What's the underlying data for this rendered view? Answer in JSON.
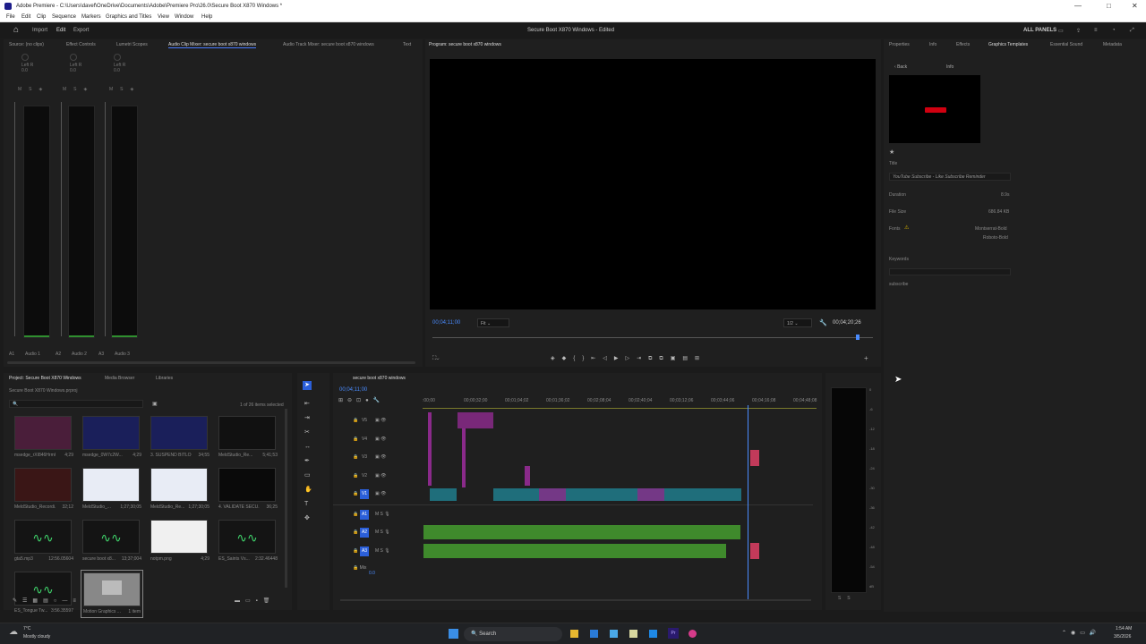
{
  "window": {
    "title": "Adobe Premiere - C:\\Users\\davef\\OneDrive\\Documents\\Adobe\\Premiere Pro\\26.0\\Secure Boot X870 Windows *"
  },
  "menu": [
    "File",
    "Edit",
    "Clip",
    "Sequence",
    "Markers",
    "Graphics and Titles",
    "View",
    "Window",
    "Help"
  ],
  "header": {
    "import": "Import",
    "edit": "Edit",
    "export": "Export",
    "project_title": "Secure Boot X870 Windows - Edited",
    "all_panels": "ALL PANELS"
  },
  "source_tabs": [
    "Source: (no clips)",
    "Effect Controls",
    "Lumetri Scopes",
    "Audio Clip Mixer: secure boot x870 windows",
    "Audio Track Mixer: secure boot x870 windows",
    "Text"
  ],
  "mixer": {
    "channels": [
      {
        "label": "Left R",
        "val": "0.0",
        "name": "Audio 1",
        "id": "A1"
      },
      {
        "label": "Left R",
        "val": "0.0",
        "name": "Audio 2",
        "id": "A2"
      },
      {
        "label": "Left R",
        "val": "0.0",
        "name": "Audio 3",
        "id": "A3"
      }
    ]
  },
  "program": {
    "tab": "Program: secure boot x870 windows",
    "timecode": "00;04;11;00",
    "fit": "Fit",
    "ratio": "1/2",
    "duration": "00;04;20;26"
  },
  "right_tabs": [
    "Properties",
    "Info",
    "Effects",
    "Graphics Templates",
    "Essential Sound",
    "Metadata"
  ],
  "graphics": {
    "back": "Back",
    "info": "Info",
    "title_label": "Title",
    "title_value": "YouTube Subscribe - Like Subscribe Reminder",
    "duration_label": "Duration",
    "duration_value": "8.9s",
    "filesize_label": "File Size",
    "filesize_value": "686.84 KB",
    "fonts_label": "Fonts",
    "font1": "Montserrat-Bold",
    "font2": "Roboto-Bold",
    "keywords_label": "Keywords",
    "keyword": "subscribe"
  },
  "project": {
    "tabs": [
      "Project: Secure Boot X870 Windows",
      "Media Browser",
      "Libraries"
    ],
    "file": "Secure Boot X870 Windows.prproj",
    "selected": "1 of 26 items selected",
    "items": [
      {
        "name": "msedge_rXI846HrmG...",
        "dur": "4;29"
      },
      {
        "name": "msedge_0W7c2W...",
        "dur": "4;29"
      },
      {
        "name": "3. SUSPEND BITLOC...",
        "dur": "34;55"
      },
      {
        "name": "MeldStudio_Re...",
        "dur": "5;41;53"
      },
      {
        "name": "MeldStudio_Recordi...",
        "dur": "32;12"
      },
      {
        "name": "MeldStudio_...",
        "dur": "1;27;30;05"
      },
      {
        "name": "MeldStudio_Re...",
        "dur": "1;27;30;05"
      },
      {
        "name": "4. VALIDATE SECU...",
        "dur": "36;25"
      },
      {
        "name": "gta5.mp3",
        "dur": "12:56.05604"
      },
      {
        "name": "secure boot x8...",
        "dur": "13;37;004"
      },
      {
        "name": "notpm.png",
        "dur": "4;29"
      },
      {
        "name": "ES_Saints Vs...",
        "dur": "2:32.46448"
      },
      {
        "name": "ES_Tongue Tw...",
        "dur": "3:56.35597"
      },
      {
        "name": "Motion Graphics ...",
        "dur": "1 item"
      }
    ]
  },
  "timeline": {
    "tab": "secure boot x870 windows",
    "timecode": "00;04;11;00",
    "ruler": [
      ":00;00",
      "00;00;32;00",
      "00;01;04;02",
      "00;01;36;02",
      "00;02;08;04",
      "00;02;40;04",
      "00;03;12;06",
      "00;03;44;06",
      "00;04;16;08",
      "00;04;48;08"
    ],
    "tracks": [
      "V5",
      "V4",
      "V3",
      "V2",
      "V1",
      "A1",
      "A2",
      "A3"
    ],
    "mix": "Mix",
    "mixval": "0.0"
  },
  "meter_scale": [
    "0",
    "-6",
    "-12",
    "-18",
    "-24",
    "-30",
    "-36",
    "-42",
    "-48",
    "-54",
    "dB"
  ],
  "taskbar": {
    "weather_temp": "7°C",
    "weather": "Mostly cloudy",
    "search": "Search",
    "time": "1:54 AM",
    "date": "3/5/2026"
  }
}
